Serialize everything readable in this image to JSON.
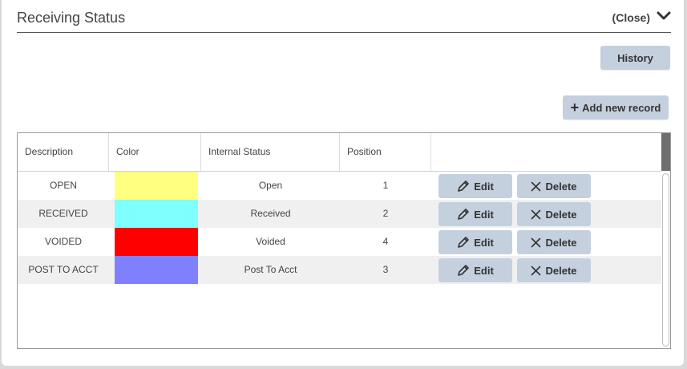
{
  "panel": {
    "title": "Receiving Status",
    "close_label": "(Close)"
  },
  "toolbar": {
    "history_label": "History",
    "add_label": "Add new record"
  },
  "table": {
    "columns": [
      "Description",
      "Color",
      "Internal Status",
      "Position"
    ],
    "edit_label": "Edit",
    "delete_label": "Delete",
    "rows": [
      {
        "description": "OPEN",
        "color": "#ffff80",
        "internal_status": "Open",
        "position": "1"
      },
      {
        "description": "RECEIVED",
        "color": "#80ffff",
        "internal_status": "Received",
        "position": "2"
      },
      {
        "description": "VOIDED",
        "color": "#ff0000",
        "internal_status": "Voided",
        "position": "4"
      },
      {
        "description": "POST TO ACCT",
        "color": "#8080ff",
        "internal_status": "Post To Acct",
        "position": "3"
      }
    ]
  }
}
